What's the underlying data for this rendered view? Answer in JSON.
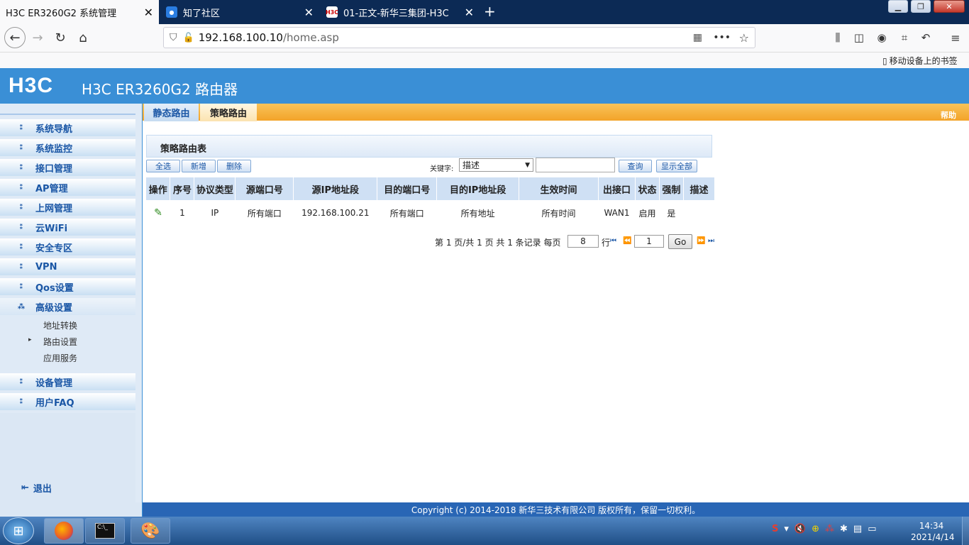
{
  "browser": {
    "tabs": [
      {
        "title": "H3C ER3260G2 系统管理",
        "active": true
      },
      {
        "title": "知了社区",
        "active": false
      },
      {
        "title": "01-正文-新华三集团-H3C",
        "active": false
      }
    ],
    "url_host": "192.168.100.10",
    "url_path": "/home.asp",
    "mobile_bookmarks": "移动设备上的书签"
  },
  "router": {
    "logo": "H3C",
    "product": "H3C ER3260G2 路由器",
    "sidebar": {
      "items": [
        {
          "label": "系统导航"
        },
        {
          "label": "系统监控"
        },
        {
          "label": "接口管理"
        },
        {
          "label": "AP管理"
        },
        {
          "label": "上网管理"
        },
        {
          "label": "云WiFi"
        },
        {
          "label": "安全专区"
        },
        {
          "label": "VPN"
        },
        {
          "label": "Qos设置"
        },
        {
          "label": "高级设置"
        },
        {
          "label": "设备管理"
        },
        {
          "label": "用户FAQ"
        }
      ],
      "subitems": [
        {
          "label": "地址转换"
        },
        {
          "label": "路由设置"
        },
        {
          "label": "应用服务"
        }
      ],
      "logout": "退出"
    },
    "tabs": [
      {
        "label": "静态路由"
      },
      {
        "label": "策略路由"
      }
    ],
    "help": "帮助",
    "section_title": "策略路由表",
    "buttons": {
      "select_all": "全选",
      "add": "新增",
      "delete": "删除",
      "query": "查询",
      "show_all": "显示全部"
    },
    "keyword_label": "关键字:",
    "keyword_select": "描述",
    "table": {
      "headers": [
        "操作",
        "序号",
        "协议类型",
        "源端口号",
        "源IP地址段",
        "目的端口号",
        "目的IP地址段",
        "生效时间",
        "出接口",
        "状态",
        "强制",
        "描述"
      ],
      "rows": [
        {
          "seq": "1",
          "protocol": "IP",
          "src_port": "所有端口",
          "src_ip": "192.168.100.21",
          "dst_port": "所有端口",
          "dst_ip": "所有地址",
          "time": "所有时间",
          "iface": "WAN1",
          "status": "启用",
          "force": "是",
          "desc": ""
        }
      ]
    },
    "pagination": {
      "summary": "第 1 页/共 1 页 共 1 条记录 每页",
      "per_page": "8",
      "rows_unit": "行",
      "page_input": "1",
      "go": "Go"
    },
    "copyright": "Copyright (c) 2014-2018 新华三技术有限公司 版权所有，保留一切权利。"
  },
  "taskbar": {
    "time": "14:34",
    "date": "2021/4/14"
  },
  "colors": {
    "header_blue": "#3a8fd6",
    "tab_orange": "#f3a329",
    "footer_blue": "#2966b5"
  }
}
